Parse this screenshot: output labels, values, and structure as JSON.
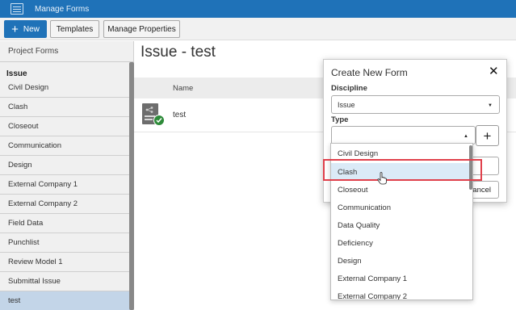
{
  "app": {
    "title": "Manage Forms",
    "icon": "form-list-icon"
  },
  "toolbar": {
    "new_icon": "plus-icon",
    "new_label": "New",
    "templates_label": "Templates",
    "manage_properties_label": "Manage Properties"
  },
  "sidebar": {
    "header": "Project Forms",
    "group_label": "Issue",
    "items": [
      {
        "label": "Civil Design"
      },
      {
        "label": "Clash"
      },
      {
        "label": "Closeout"
      },
      {
        "label": "Communication"
      },
      {
        "label": "Design"
      },
      {
        "label": "External Company 1"
      },
      {
        "label": "External Company 2"
      },
      {
        "label": "Field Data"
      },
      {
        "label": "Punchlist"
      },
      {
        "label": "Review Model 1"
      },
      {
        "label": "Submittal Issue"
      },
      {
        "label": "test",
        "selected": true
      }
    ]
  },
  "main": {
    "title": "Issue - test",
    "column_name": "Name",
    "rows": [
      {
        "name": "test",
        "icon": "form-document-icon",
        "status_icon": "check-icon"
      }
    ]
  },
  "dialog": {
    "title": "Create New Form",
    "close_icon": "close-icon",
    "discipline_label": "Discipline",
    "discipline_value": "Issue",
    "type_label": "Type",
    "type_value": "",
    "add_icon": "plus-icon",
    "cancel_label": "Cancel",
    "cancel_visible_text": "ancel",
    "type_options": [
      "Civil Design",
      "Clash",
      "Closeout",
      "Communication",
      "Data Quality",
      "Deficiency",
      "Design",
      "External Company 1",
      "External Company 2"
    ],
    "hovered_option": "Clash"
  },
  "colors": {
    "accent": "#1f72b8",
    "selected_row": "#c3d5e8",
    "highlight": "#e0404b",
    "success": "#2e8b3a"
  }
}
